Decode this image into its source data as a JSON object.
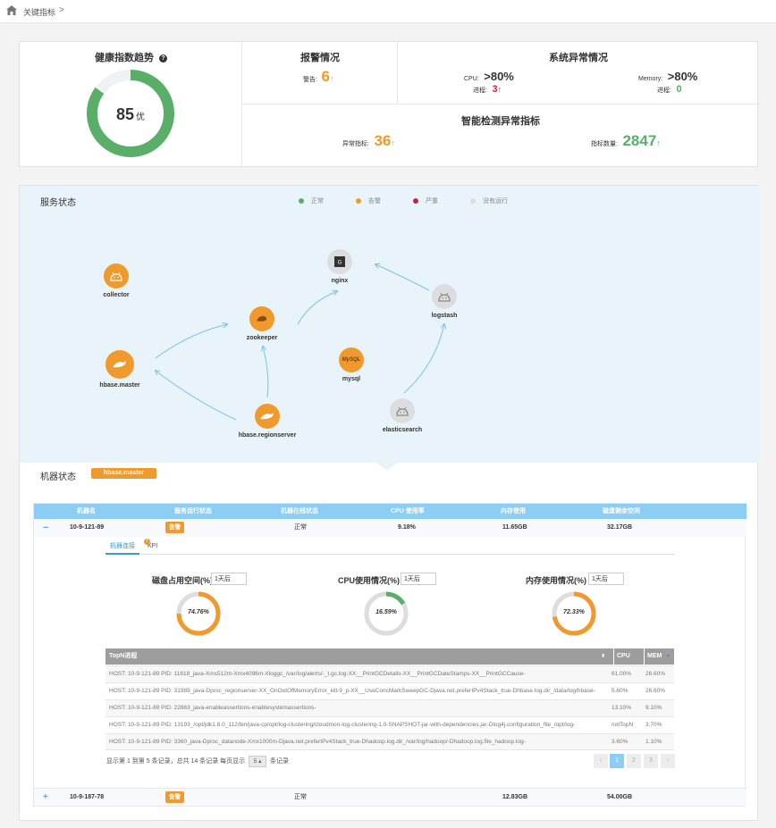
{
  "breadcrumb": {
    "title": "关键指标",
    "sep": ">"
  },
  "health": {
    "title": "健康指数趋势",
    "help": "?",
    "score": "85",
    "grade": "优",
    "ratio": 0.85
  },
  "alarm": {
    "title": "报警情况",
    "label": "警告:",
    "value": "6",
    "arrow": "↑"
  },
  "sys": {
    "title": "系统异常情况",
    "cpu_label": "CPU:",
    "cpu_value": ">80%",
    "cpu_proc_label": "进程:",
    "cpu_proc_value": "3",
    "mem_label": "Memory:",
    "mem_value": ">80%",
    "mem_proc_label": "进程:",
    "mem_proc_value": "0",
    "arrow": "↑"
  },
  "smart": {
    "title": "智能检测异常指标",
    "abn_label": "异常指标:",
    "abn_value": "36",
    "count_label": "指标数量:",
    "count_value": "2847",
    "arrow": "↑"
  },
  "service": {
    "title": "服务状态",
    "legend": [
      {
        "label": "正常",
        "color": "#5aaf68"
      },
      {
        "label": "告警",
        "color": "#f0992c"
      },
      {
        "label": "严重",
        "color": "#c0273f"
      },
      {
        "label": "没有运行",
        "color": "#dddddd"
      }
    ],
    "nodes": {
      "collector": "collector",
      "zookeeper": "zookeeper",
      "nginx": "nginx",
      "logstash": "logstash",
      "hbase_master": "hbase.master",
      "mysql": "mysql",
      "regionserver": "hbase.regionserver",
      "elasticsearch": "elasticsearch"
    },
    "mysql_logo": "MySQL"
  },
  "machine": {
    "title": "机器状态",
    "tag": "hbase.master",
    "columns": [
      "机器名",
      "服务运行状态",
      "机器在线状态",
      "CPU 使用率",
      "内存使用",
      "磁盘剩余空间"
    ],
    "rows": [
      {
        "toggle": "−",
        "name": "10-9-121-89",
        "status": "告警",
        "online": "正常",
        "cpu": "9.18%",
        "mem": "11.65GB",
        "disk": "32.17GB"
      },
      {
        "toggle": "+",
        "name": "10-9-187-78",
        "status": "告警",
        "online": "正常",
        "cpu": "",
        "mem": "12.83GB",
        "disk": "54.00GB"
      }
    ],
    "tabs": {
      "conn": "机器连接",
      "kpi": "KPI",
      "kpi_badge": "!"
    },
    "gauges": [
      {
        "title": "磁盘占用空间(%)",
        "select": "1天后",
        "value": "74.76%",
        "ratio": 0.7476
      },
      {
        "title": "CPU使用情况(%)",
        "select": "1天后",
        "value": "16.59%",
        "ratio": 0.1659
      },
      {
        "title": "内存使用情况(%)",
        "select": "1天后",
        "value": "72.33%",
        "ratio": 0.7233
      }
    ],
    "topn": {
      "columns": [
        "TopN进程",
        "CPU",
        "MEM"
      ],
      "rows": [
        {
          "proc": "HOST: 10-9-121-89    PID: 11618_java-Xms512m-Xmx4096m-Xloggc_/var/log/alerts/-_t.gc.log-XX__PrintGCDetails-XX__PrintGCDateStamps-XX__PrintGCCause-",
          "cpu": "61.00%",
          "mem": "26.60%"
        },
        {
          "proc": "HOST: 10-9-121-89    PID: 31989_java-Dproc_regionserver-XX_OnOutOfMemoryError_kill-9_p-XX__UseConcMarkSweepGC-Djava.net.preferIPv4Stack_true-Dhbase.log.dir_/data/log/hbase-",
          "cpu": "5.60%",
          "mem": "26.60%"
        },
        {
          "proc": "HOST: 10-9-121-89    PID: 22863_java-enableassertions-enablesystemassertions-",
          "cpu": "13.10%",
          "mem": "9.10%"
        },
        {
          "proc": "HOST: 10-9-121-89    PID: 13193_/opt/jdk1.8.0_112/bin/java-cp/opt/log-clustering/cloudmon-log-clustering-1.0-SNAPSHOT-jar-with-dependencies.jar-Dlog4j.configuration_file_/opt/log-",
          "cpu": "notTopN",
          "mem": "3.70%"
        },
        {
          "proc": "HOST: 10-9-121-89    PID: 3360_java-Dproc_datanode-Xmx1000m-Djava.net.preferIPv4Stack_true-Dhadoop.log.dir_/var/log/hadoop/-Dhadoop.log.file_hadoop.log-",
          "cpu": "3.60%",
          "mem": "1.10%"
        }
      ],
      "footer_a": "显示第 1 到第 5 条记录，总共 14 条记录 每页显示",
      "page_size": "5 ▴",
      "footer_b": "条记录",
      "pages": [
        "‹",
        "1",
        "2",
        "3",
        "›"
      ]
    }
  }
}
